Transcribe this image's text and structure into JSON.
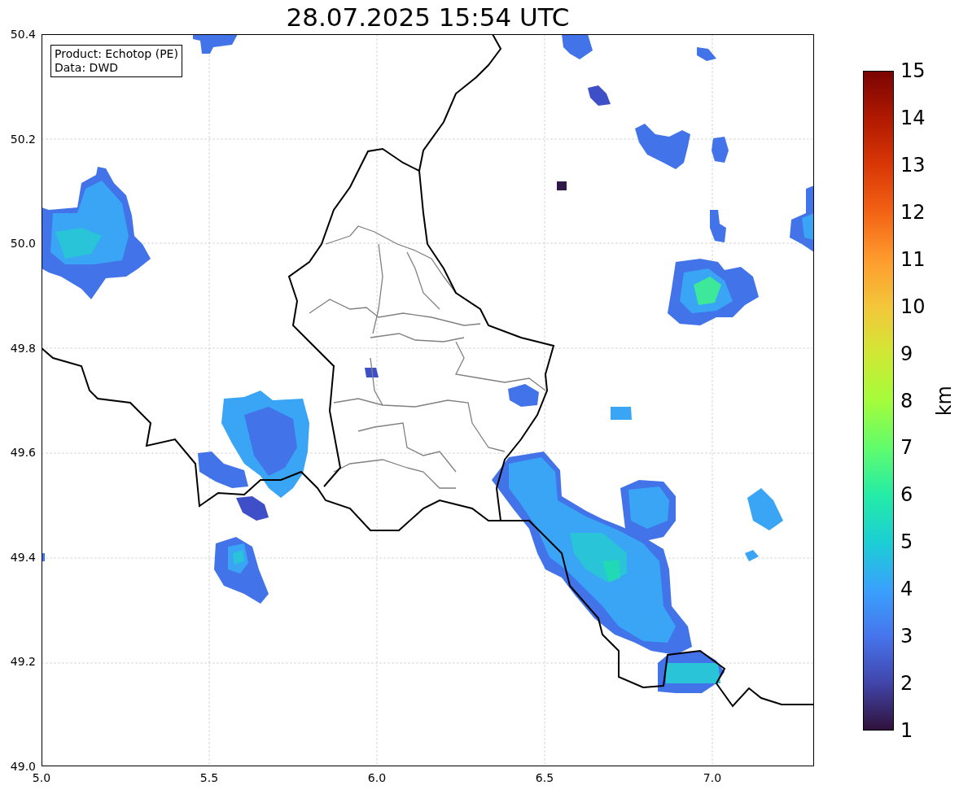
{
  "title": "28.07.2025 15:54 UTC",
  "info_box": {
    "lines": [
      "Product: Echotop (PE)",
      "Data: DWD"
    ]
  },
  "y_ticks": [
    "50.4",
    "50.2",
    "50.0",
    "49.8",
    "49.6",
    "49.4",
    "49.2",
    "49.0"
  ],
  "x_ticks": [
    "5.0",
    "5.5",
    "6.0",
    "6.5",
    "7.0"
  ],
  "colorbar": {
    "label": "km",
    "ticks": [
      "15",
      "14",
      "13",
      "12",
      "11",
      "10",
      "9",
      "8",
      "7",
      "6",
      "5",
      "4",
      "3",
      "2",
      "1"
    ]
  }
}
